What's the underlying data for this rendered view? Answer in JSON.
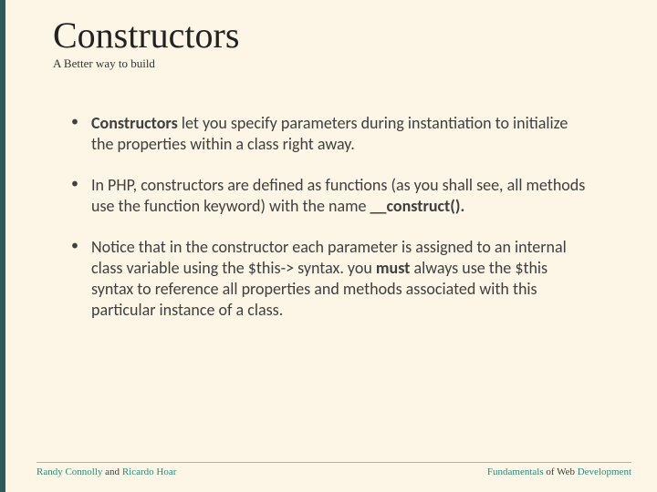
{
  "title": "Constructors",
  "subtitle": "A Better way to build",
  "bullets": {
    "b1_bold": "Constructors",
    "b1_rest": " let you specify parameters during instantiation to initialize the properties within a class right away.",
    "b2_pre": "In PHP, constructors are defined as functions (as you shall see, all methods use the function keyword) with the name ",
    "b2_bold": "__construct().",
    "b3_pre": "Notice that in the constructor each parameter is assigned to an internal class variable using the $this-> syntax. you ",
    "b3_bold": "must",
    "b3_post": " always use the $this syntax to reference all properties and methods associated with this particular instance of a class."
  },
  "footer": {
    "left_author1": "Randy Connolly",
    "left_and": " and ",
    "left_author2": "Ricardo Hoar",
    "right_word1": "Fundamentals",
    "right_mid": " of Web ",
    "right_word2": "Development"
  }
}
